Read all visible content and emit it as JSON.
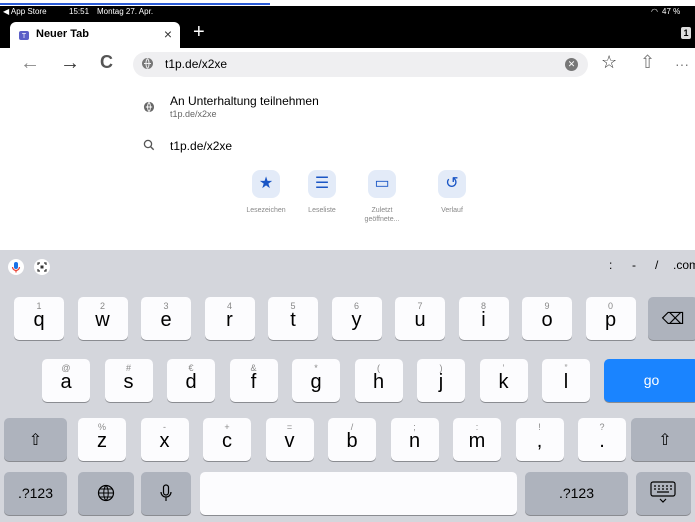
{
  "status_bar": {
    "back_app": "◀ App Store",
    "time": "15:51",
    "date": "Montag 27. Apr.",
    "wifi_icon": "wifi-icon",
    "battery": "47 %"
  },
  "tabs": [
    {
      "title": "Neuer Tab",
      "close": "×"
    }
  ],
  "new_tab": "+",
  "tab_count": "1",
  "toolbar": {
    "back": "←",
    "forward": "→",
    "reload": "C",
    "url": "t1p.de/x2xe",
    "bookmark": "☆",
    "share": "⇧",
    "more": "···"
  },
  "suggestions": [
    {
      "icon": "globe-icon",
      "title": "An Unterhaltung teilnehmen",
      "subtitle": "t1p.de/x2xe"
    },
    {
      "icon": "search-icon",
      "title": "t1p.de/x2xe",
      "subtitle": ""
    }
  ],
  "quick_links": [
    {
      "icon": "star-icon",
      "glyph": "★",
      "label": "Lesezeichen"
    },
    {
      "icon": "list-icon",
      "glyph": "☰",
      "label": "Leseliste"
    },
    {
      "icon": "devices-icon",
      "glyph": "▭",
      "label": "Zuletzt geöffnete..."
    },
    {
      "icon": "history-icon",
      "glyph": "↺",
      "label": "Verlauf"
    }
  ],
  "keyboard": {
    "shortcuts": [
      ":",
      "-",
      "/",
      ".com"
    ],
    "row1": [
      [
        "1",
        "q"
      ],
      [
        "2",
        "w"
      ],
      [
        "3",
        "e"
      ],
      [
        "4",
        "r"
      ],
      [
        "5",
        "t"
      ],
      [
        "6",
        "y"
      ],
      [
        "7",
        "u"
      ],
      [
        "8",
        "i"
      ],
      [
        "9",
        "o"
      ],
      [
        "0",
        "p"
      ]
    ],
    "row2": [
      [
        "@",
        "a"
      ],
      [
        "#",
        "s"
      ],
      [
        "€",
        "d"
      ],
      [
        "&",
        "f"
      ],
      [
        "*",
        "g"
      ],
      [
        "(",
        "h"
      ],
      [
        ")",
        "j"
      ],
      [
        "’",
        "k"
      ],
      [
        "”",
        "l"
      ]
    ],
    "row3": [
      [
        "%",
        "z"
      ],
      [
        "-",
        "x"
      ],
      [
        "+",
        "c"
      ],
      [
        "=",
        "v"
      ],
      [
        "/",
        "b"
      ],
      [
        ";",
        "n"
      ],
      [
        ":",
        "m"
      ],
      [
        "!",
        ","
      ],
      [
        "?",
        "."
      ]
    ],
    "go": "go",
    "num": ".?123",
    "backspace": "⌫",
    "shift": "⇧"
  }
}
